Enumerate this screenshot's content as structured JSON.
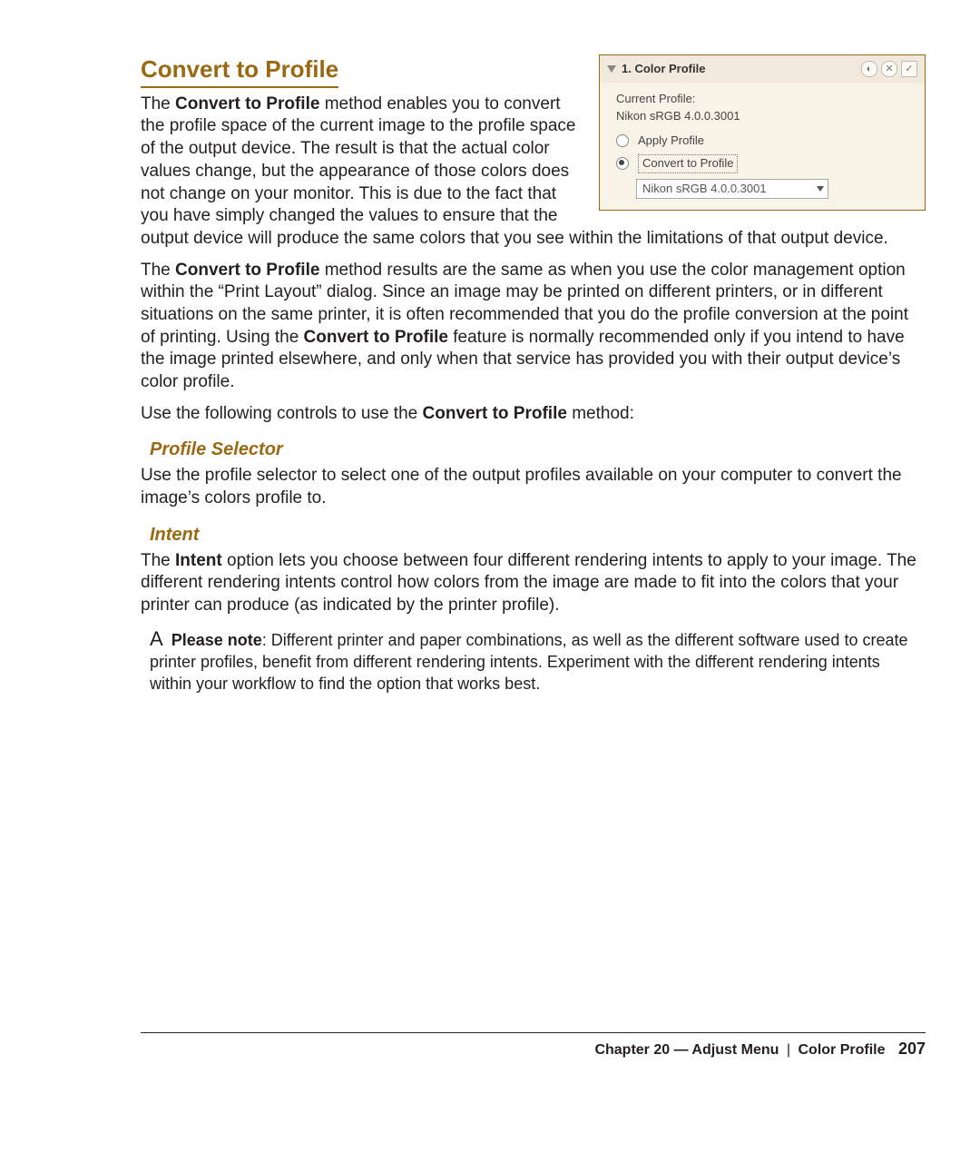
{
  "heading": "Convert to Profile",
  "ui": {
    "panel_title": "1. Color Profile",
    "current_profile_label": "Current Profile:",
    "current_profile_value": "Nikon sRGB 4.0.0.3001",
    "radio_apply": "Apply Profile",
    "radio_convert": "Convert to Profile",
    "select_value": "Nikon sRGB 4.0.0.3001"
  },
  "p1": {
    "a": "The ",
    "b": "Convert to Profile",
    "c": " method enables you to convert the profile space of the current image to the profile space of the output device. The result is that the actual color values change, but the appearance of those colors does not change on your monitor. This is due to the fact that you have simply changed the values to ensure that the output device will produce the same colors that you see within the limitations of that output device."
  },
  "p2": {
    "a": "The ",
    "b": "Convert to Profile",
    "c": " method results are the same as when you use the color management option within the “Print Layout” dialog. Since an image may be printed on different printers, or in different situations on the same printer, it is often recommended that you do the profile conversion at the point of printing. Using the ",
    "d": "Convert to Profile",
    "e": " feature is normally recommended only if you intend to have the image printed elsewhere, and only when that service has provided you with their output device’s color profile."
  },
  "p3": {
    "a": "Use the following controls to use the ",
    "b": "Convert to Profile",
    "c": " method:"
  },
  "profile_selector": {
    "title": "Profile Selector",
    "body": "Use the profile selector to select one of the output profiles available on your computer to convert the image’s colors profile to."
  },
  "intent": {
    "title": "Intent",
    "body_a": "The ",
    "body_b": "Intent",
    "body_c": " option lets you choose between four different rendering intents to apply to your image. The different rendering intents control how colors from the image are made to fit into the colors that your printer can produce (as indicated by the printer profile)."
  },
  "note": {
    "icon": "A",
    "label": "Please note",
    "body": ": Different printer and paper combinations, as well as the different software used to create printer profiles, benefit from different rendering intents. Experiment with the different rendering intents within your workflow to find the option that works best."
  },
  "footer": {
    "chapter": "Chapter 20 — Adjust Menu",
    "section": "Color Profile",
    "page": "207"
  }
}
